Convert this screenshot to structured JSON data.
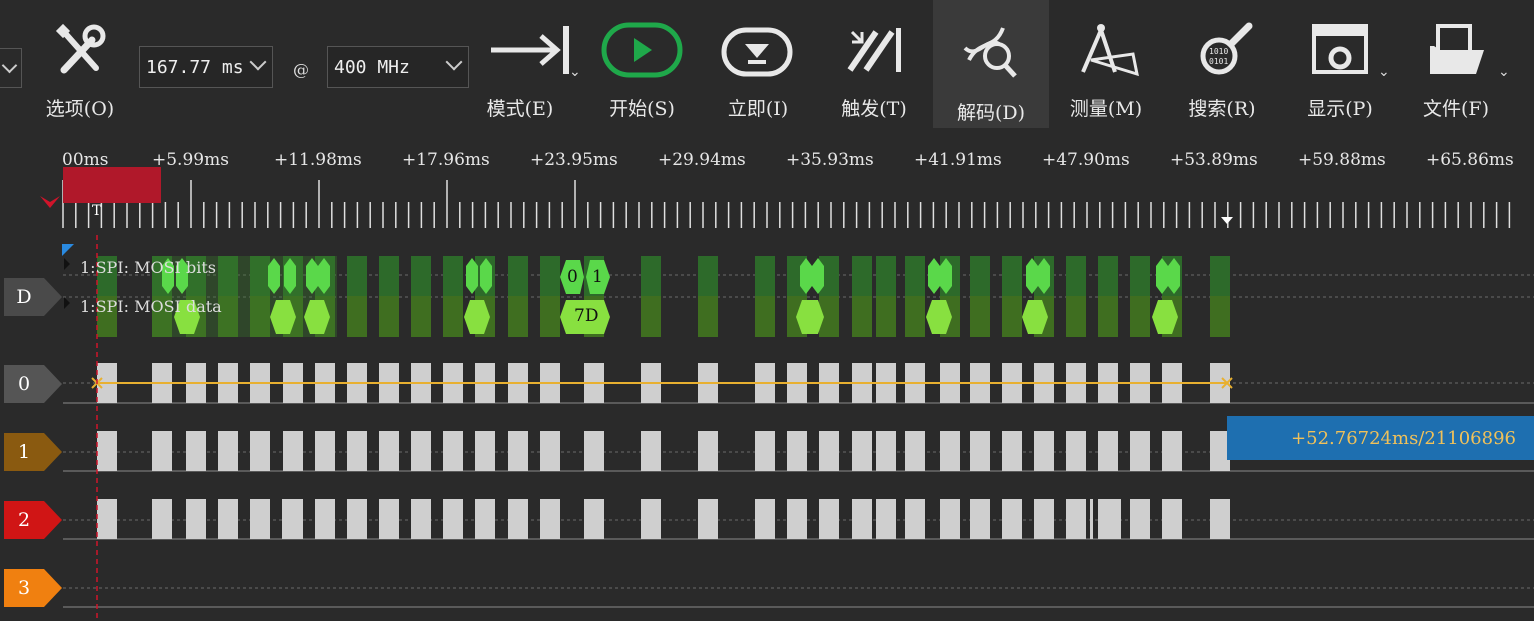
{
  "toolbar": {
    "options_label": "选项(O)",
    "duration_value": "167.77 ms",
    "at_sign": "@",
    "samplerate_value": "400 MHz",
    "mode_label": "模式(E)",
    "start_label": "开始(S)",
    "instant_label": "立即(I)",
    "trigger_label": "触发(T)",
    "decode_label": "解码(D)",
    "measure_label": "测量(M)",
    "search_label": "搜索(R)",
    "display_label": "显示(P)",
    "file_label": "文件(F)"
  },
  "ruler": {
    "labels": [
      "00ms",
      "+5.99ms",
      "+11.98ms",
      "+17.96ms",
      "+23.95ms",
      "+29.94ms",
      "+35.93ms",
      "+41.91ms",
      "+47.90ms",
      "+53.89ms",
      "+59.88ms",
      "+65.86ms"
    ],
    "trigger_marker": "T"
  },
  "decoder": {
    "tag": "D",
    "row1_label": "1:SPI: MOSI bits",
    "row2_label": "1:SPI: MOSI data",
    "bit_values": [
      "0",
      "1"
    ],
    "data_value": "7D"
  },
  "channels": [
    {
      "name": "0",
      "color": "#555555"
    },
    {
      "name": "1",
      "color": "#8a5a10"
    },
    {
      "name": "2",
      "color": "#d01515"
    },
    {
      "name": "3",
      "color": "#f08010"
    }
  ],
  "measurement": {
    "text": "+52.76724ms/21106896"
  },
  "colors": {
    "accent_green": "#1fa84a",
    "trigger_red": "#b0182a",
    "cursor_yellow": "#e8b030",
    "measure_blue": "#1e6fb0"
  }
}
